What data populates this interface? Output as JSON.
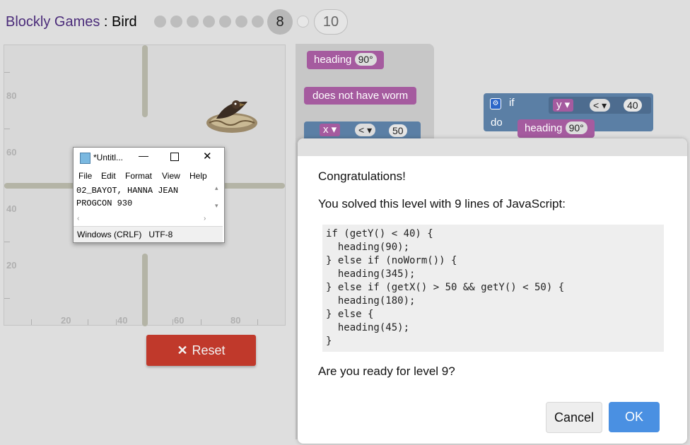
{
  "header": {
    "app_name": "Blockly Games",
    "separator": " : ",
    "game": "Bird",
    "current_level": "8",
    "last_level": "10"
  },
  "grid": {
    "y_labels": [
      "80",
      "60",
      "40",
      "20"
    ],
    "x_labels": [
      "20",
      "40",
      "60",
      "80"
    ]
  },
  "blocks": {
    "flyout_heading": "heading",
    "flyout_heading_value": "90°",
    "no_worm": "does not have worm",
    "x_var": "x",
    "x_op": "<",
    "x_value": "50",
    "if": "if",
    "do": "do",
    "y_var": "y",
    "y_op": "<",
    "y_value": "40",
    "ws_heading": "heading",
    "ws_heading_value": "90°"
  },
  "reset_button": {
    "label": "Reset"
  },
  "notepad": {
    "title": "*Untitl...",
    "menu": [
      "File",
      "Edit",
      "Format",
      "View",
      "Help"
    ],
    "line1": "02_BAYOT, HANNA JEAN",
    "line2": "PROGCON 930",
    "status": "Windows (CRLF)   UTF-8"
  },
  "dialog": {
    "heading": "Congratulations!",
    "subtitle": "You solved this level with 9 lines of JavaScript:",
    "code_lines": [
      "if (getY() < 40) {",
      "  heading(90);",
      "} else if (noWorm()) {",
      "  heading(345);",
      "} else if (getX() > 50 && getY() < 50) {",
      "  heading(180);",
      "} else {",
      "  heading(45);",
      "}"
    ],
    "question": "Are you ready for level 9?",
    "cancel_label": "Cancel",
    "ok_label": "OK"
  },
  "colors": {
    "accent": "#4a90e2",
    "reset": "#c0392b",
    "heading_block": "#a55b9f",
    "logic_block": "#5b7fa5"
  }
}
